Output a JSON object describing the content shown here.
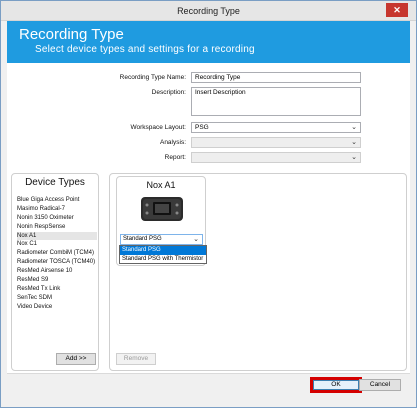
{
  "window": {
    "title": "Recording Type",
    "close_glyph": "✕"
  },
  "header": {
    "title": "Recording Type",
    "subtitle": "Select device types and settings for a recording"
  },
  "form": {
    "name_label": "Recording Type Name:",
    "name_value": "Recording Type",
    "description_label": "Description:",
    "description_value": "Insert Description",
    "workspace_label": "Workspace Layout:",
    "workspace_value": "PSG",
    "analysis_label": "Analysis:",
    "analysis_value": "",
    "report_label": "Report:",
    "report_value": ""
  },
  "device_types": {
    "title": "Device Types",
    "items": [
      "Blue Giga Access Point",
      "Masimo Radical-7",
      "Nonin 3150 Oximeter",
      "Nonin RespSense",
      "Nox A1",
      "Nox C1",
      "Radiometer CombiM (TCM4)",
      "Radiometer TOSCA (TCM40)",
      "ResMed Airsense 10",
      "ResMed S9",
      "ResMed Tx Link",
      "SenTec SDM",
      "Video Device"
    ],
    "selected_index": 4,
    "add_label": "Add >>"
  },
  "recording_types": {
    "card_title": "Nox A1",
    "selected_setting": "Standard PSG",
    "options": [
      "Standard PSG",
      "Standard PSG with Thermistor"
    ],
    "highlighted_option_index": 0,
    "remove_label": "Remove"
  },
  "footer": {
    "ok_label": "OK",
    "cancel_label": "Cancel"
  },
  "colors": {
    "header_bg": "#1f9be0",
    "highlight": "#d40000",
    "selection": "#0078d7"
  }
}
